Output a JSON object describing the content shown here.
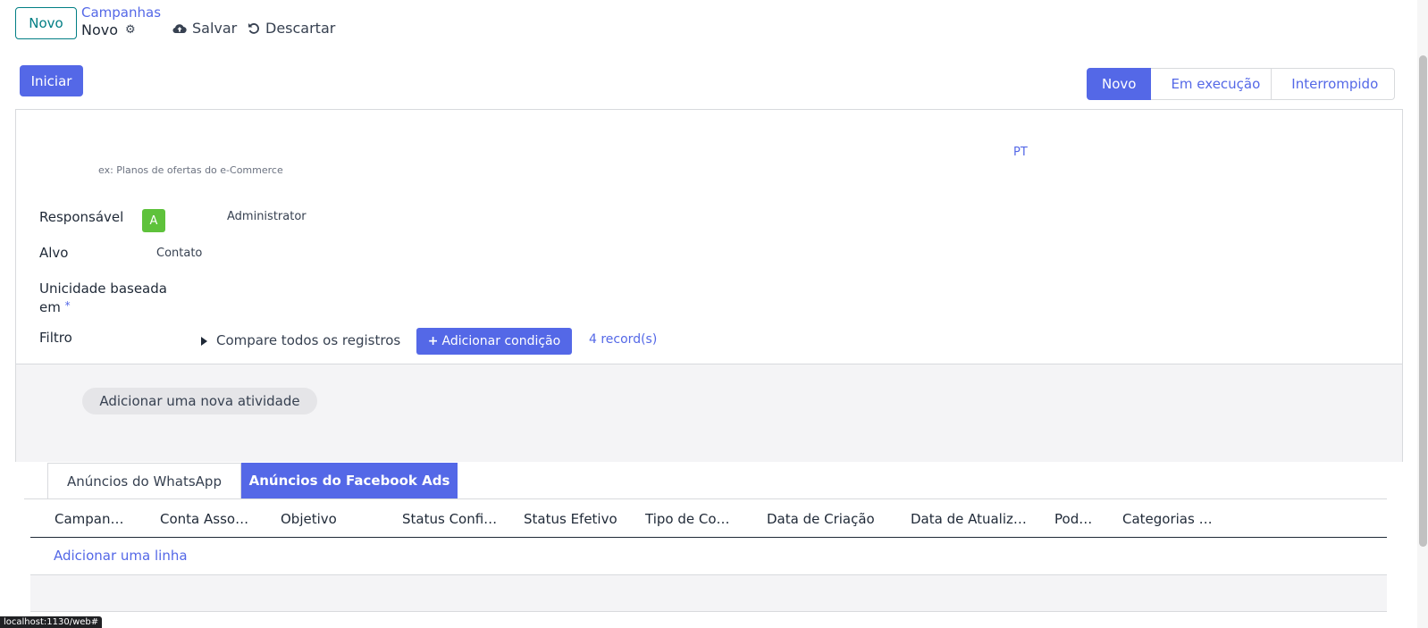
{
  "control_panel": {
    "new_button": "Novo",
    "breadcrumb_parent": "Campanhas",
    "breadcrumb_current": "Novo",
    "save_label": "Salvar",
    "discard_label": "Descartar"
  },
  "statusbar": {
    "start_button": "Iniciar",
    "stages": [
      {
        "label": "Novo",
        "active": true
      },
      {
        "label": "Em execução",
        "active": false
      },
      {
        "label": "Interrompido",
        "active": false
      }
    ]
  },
  "form": {
    "name_placeholder": "ex: Planos de ofertas do e-Commerce",
    "lang_badge": "PT",
    "fields": {
      "responsible_label": "Responsável",
      "responsible_avatar": "A",
      "responsible_value": "Administrator",
      "target_label": "Alvo",
      "target_value": "Contato",
      "uniqueness_label_line1": "Unicidade baseada",
      "uniqueness_label_line2": "em",
      "required_marker": "*",
      "filter_label": "Filtro",
      "filter_compare": "Compare todos os registros",
      "add_condition": "Adicionar condição",
      "records_count": "4 record(s)"
    },
    "add_activity": "Adicionar uma nova atividade"
  },
  "tabs": [
    {
      "label": "Anúncios do WhatsApp",
      "active": false
    },
    {
      "label": "Anúncios do Facebook Ads",
      "active": true
    }
  ],
  "table": {
    "columns": [
      "Campan…",
      "Conta Asso…",
      "Objetivo",
      "Status Confi…",
      "Status Efetivo",
      "Tipo de Co…",
      "Data de Criação",
      "Data de Atualiz…",
      "Pod…",
      "Categorias …"
    ],
    "add_line": "Adicionar uma linha"
  },
  "status_url": "localhost:1130/web#",
  "colors": {
    "primary": "#5468e7",
    "teal": "#017e84",
    "avatar": "#5ec23b"
  }
}
